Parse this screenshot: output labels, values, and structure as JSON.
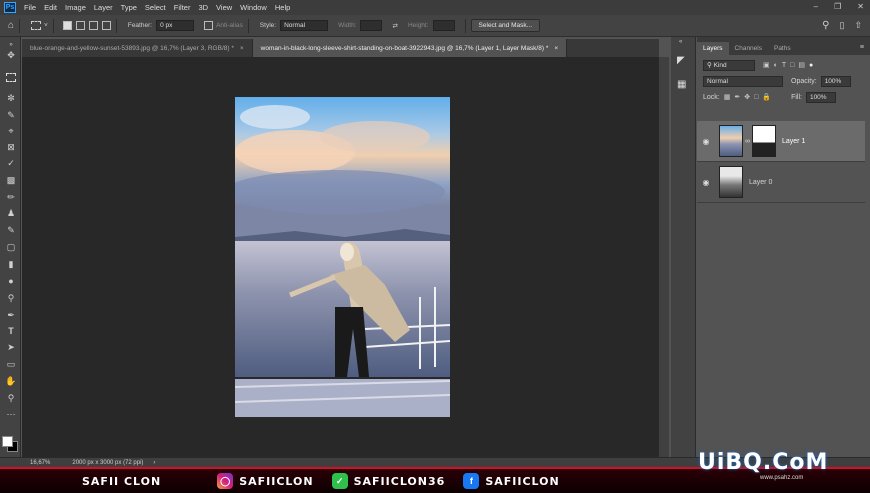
{
  "menu": {
    "logo": "Ps",
    "items": [
      "File",
      "Edit",
      "Image",
      "Layer",
      "Type",
      "Select",
      "Filter",
      "3D",
      "View",
      "Window",
      "Help"
    ]
  },
  "options": {
    "feather_label": "Feather:",
    "feather_value": "0 px",
    "antialias_label": "Anti-alias",
    "style_label": "Style:",
    "style_value": "Normal",
    "width_label": "Width:",
    "height_label": "Height:",
    "select_mask_label": "Select and Mask..."
  },
  "tabs": [
    {
      "label": "blue-orange-and-yellow-sunset-53893.jpg @ 16,7% (Layer 3, RGB/8) *"
    },
    {
      "label": "woman-in-black-long-sleeve-shirt-standing-on-boat-3922943.jpg @ 16,7% (Layer 1, Layer Mask/8) *"
    }
  ],
  "panel": {
    "tabs": [
      "Layers",
      "Channels",
      "Paths"
    ],
    "kind_label": "Kind",
    "blend_mode": "Normal",
    "opacity_label": "Opacity:",
    "opacity_value": "100%",
    "lock_label": "Lock:",
    "fill_label": "Fill:",
    "fill_value": "100%",
    "layers": [
      {
        "name": "Layer 1"
      },
      {
        "name": "Layer 0"
      }
    ]
  },
  "status": {
    "zoom": "16,67%",
    "doc_info": "2000 px x 3000 px (72 ppi)"
  },
  "banner": {
    "name": "SAFII CLON",
    "instagram": "SAFIICLON",
    "tiktok": "SAFIICLON36",
    "facebook": "SAFIICLON",
    "watermark": "UiBQ.CoM",
    "watermark_sub": "www.psahz.com"
  },
  "colors": {
    "accent": "#31a8ff",
    "banner_red": "#d1102a"
  }
}
